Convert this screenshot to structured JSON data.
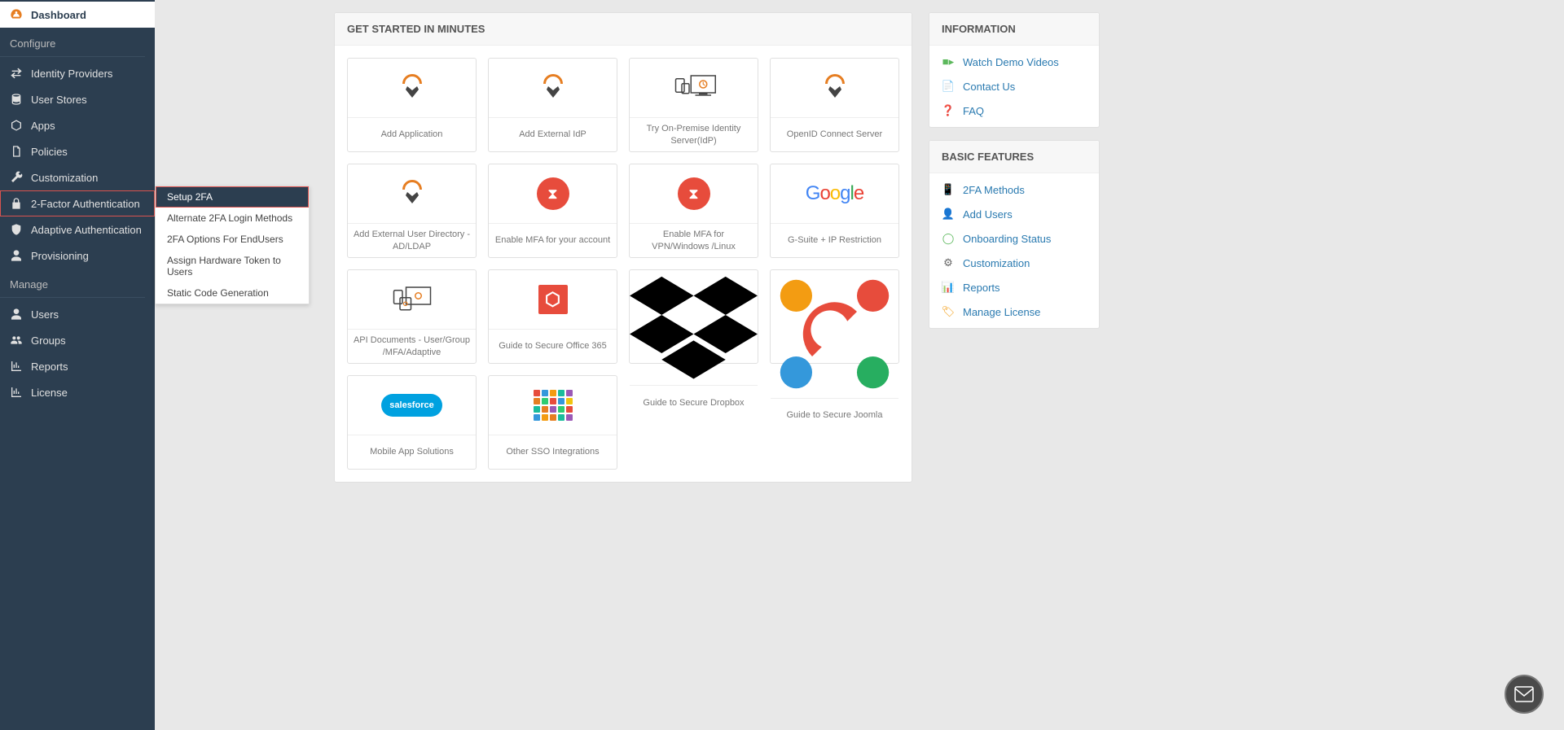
{
  "sidebar": {
    "dashboard": "Dashboard",
    "section_configure": "Configure",
    "identity_providers": "Identity Providers",
    "user_stores": "User Stores",
    "apps": "Apps",
    "policies": "Policies",
    "customization": "Customization",
    "two_factor": "2-Factor Authentication",
    "adaptive_auth": "Adaptive Authentication",
    "provisioning": "Provisioning",
    "section_manage": "Manage",
    "users": "Users",
    "groups": "Groups",
    "reports": "Reports",
    "license": "License"
  },
  "submenu": {
    "setup_2fa": "Setup 2FA",
    "alternate_login": "Alternate 2FA Login Methods",
    "options_endusers": "2FA Options For EndUsers",
    "assign_token": "Assign Hardware Token to Users",
    "static_code": "Static Code Generation"
  },
  "main_panel": {
    "title": "GET STARTED IN MINUTES",
    "cards": {
      "add_application": "Add Application",
      "add_external_idp": "Add External IdP",
      "try_onpremise": "Try On-Premise Identity Server(IdP)",
      "openid_connect": "OpenID Connect Server",
      "add_external_dir": "Add External User Directory - AD/LDAP",
      "enable_mfa_account": "Enable MFA for your account",
      "enable_mfa_vpn": "Enable MFA for VPN/Windows /Linux",
      "gsuite_ip": "G-Suite + IP Restriction",
      "api_docs": "API Documents - User/Group /MFA/Adaptive",
      "guide_office": "Guide to Secure Office 365",
      "guide_dropbox": "Guide to Secure Dropbox",
      "guide_joomla": "Guide to Secure Joomla",
      "mobile_app": "Mobile App Solutions",
      "other_sso": "Other SSO Integrations"
    }
  },
  "info_panel": {
    "title": "INFORMATION",
    "watch_demo": "Watch Demo Videos",
    "contact_us": "Contact Us",
    "faq": "FAQ"
  },
  "features_panel": {
    "title": "BASIC FEATURES",
    "tfa_methods": "2FA Methods",
    "add_users": "Add Users",
    "onboarding": "Onboarding Status",
    "customization": "Customization",
    "reports": "Reports",
    "manage_license": "Manage License"
  }
}
